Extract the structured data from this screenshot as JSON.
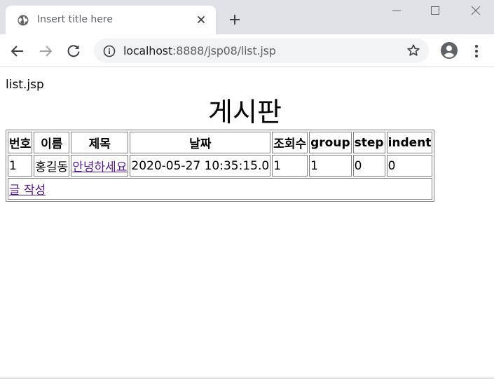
{
  "browser": {
    "tab_title": "Insert title here",
    "url_host": "localhost",
    "url_rest": ":8888/jsp08/list.jsp"
  },
  "page": {
    "filename": "list.jsp",
    "heading": "게시판",
    "table": {
      "headers": [
        "번호",
        "이름",
        "제목",
        "날짜",
        "조회수",
        "group",
        "step",
        "indent"
      ],
      "rows": [
        [
          "1",
          "홍길동",
          "안녕하세요",
          "2020-05-27 10:35:15.0",
          "1",
          "1",
          "0",
          "0"
        ]
      ],
      "write_link": "글 작성"
    }
  },
  "icons": {
    "favicon": "globe-icon",
    "tab_close": "close-icon",
    "new_tab": "plus-icon",
    "back": "arrow-left-icon",
    "forward": "arrow-right-icon",
    "reload": "reload-icon",
    "site_info": "info-icon",
    "bookmark": "star-icon",
    "profile": "account-icon",
    "menu": "kebab-menu-icon"
  }
}
